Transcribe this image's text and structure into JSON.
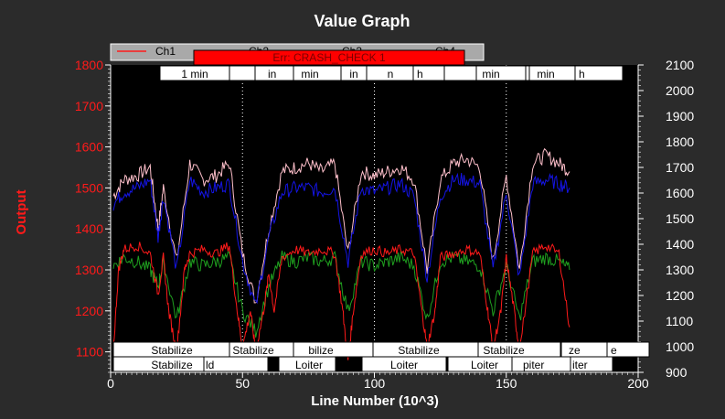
{
  "title": "Value Graph",
  "xlabel": "Line Number (10^3)",
  "ylabel": "Output",
  "legend": {
    "visible_labels": [
      "Ch1",
      "Ch2",
      "Ch3",
      "Ch4"
    ]
  },
  "error_banner": "Err: CRASH_CHECK 1",
  "time_markers": [
    "1 min",
    "in",
    "min",
    "in",
    "n",
    "h",
    "min",
    "min",
    "h"
  ],
  "mode_row_1": [
    "Stabilize",
    "Stabilize",
    "bilize",
    "Stabilize",
    "Stabilize",
    "ze",
    "e"
  ],
  "mode_row_2": [
    "Stabilize",
    "ld",
    "Loiter",
    "Loiter",
    "Loiter",
    "piter",
    "iter"
  ],
  "colors": {
    "background": "#2b2b2b",
    "plot_bg": "#000000",
    "axis_left": "#ff1a1a",
    "axis_text": "#ffffff",
    "ch_red": "#ff1a1a",
    "ch_green": "#1fa01f",
    "ch_blue": "#1414e6",
    "ch_pink": "#ffc0cb",
    "ch_magenta": "#ff00ff"
  },
  "chart_data": {
    "type": "line",
    "xlim": [
      0,
      200
    ],
    "ylim_left": [
      1050,
      1800
    ],
    "ylim_right": [
      900,
      2100
    ],
    "x_ticks": [
      0,
      50,
      100,
      150,
      200
    ],
    "y_left_ticks": [
      1100,
      1200,
      1300,
      1400,
      1500,
      1600,
      1700,
      1800
    ],
    "y_right_ticks": [
      900,
      1000,
      1100,
      1200,
      1300,
      1400,
      1500,
      1600,
      1700,
      1800,
      1900,
      2000,
      2100
    ],
    "vertical_guides_x": [
      50,
      100,
      150
    ],
    "series": [
      {
        "color": "#ffc0cb",
        "axis": "left",
        "x": [
          1,
          5,
          10,
          15,
          18,
          20,
          25,
          30,
          35,
          40,
          45,
          50,
          55,
          60,
          65,
          70,
          75,
          80,
          85,
          90,
          95,
          100,
          105,
          110,
          115,
          120,
          125,
          130,
          135,
          140,
          145,
          150,
          155,
          160,
          165,
          170,
          174
        ],
        "values": [
          1480,
          1520,
          1530,
          1550,
          1400,
          1500,
          1320,
          1560,
          1520,
          1530,
          1560,
          1340,
          1220,
          1400,
          1540,
          1550,
          1560,
          1540,
          1560,
          1340,
          1540,
          1530,
          1540,
          1550,
          1520,
          1300,
          1520,
          1560,
          1570,
          1550,
          1320,
          1530,
          1300,
          1560,
          1580,
          1560,
          1540
        ]
      },
      {
        "color": "#1414e6",
        "axis": "left",
        "x": [
          1,
          5,
          10,
          15,
          18,
          20,
          25,
          30,
          35,
          40,
          45,
          50,
          55,
          60,
          65,
          70,
          75,
          80,
          85,
          90,
          95,
          100,
          105,
          110,
          115,
          120,
          125,
          130,
          135,
          140,
          145,
          150,
          155,
          160,
          165,
          170,
          174
        ],
        "values": [
          1460,
          1490,
          1500,
          1520,
          1380,
          1480,
          1300,
          1520,
          1490,
          1500,
          1510,
          1320,
          1210,
          1380,
          1490,
          1500,
          1500,
          1490,
          1500,
          1320,
          1500,
          1490,
          1500,
          1510,
          1480,
          1280,
          1480,
          1520,
          1520,
          1510,
          1300,
          1490,
          1280,
          1510,
          1520,
          1510,
          1500
        ]
      },
      {
        "color": "#1fa01f",
        "axis": "left",
        "x": [
          1,
          5,
          10,
          15,
          18,
          20,
          25,
          30,
          35,
          40,
          45,
          50,
          55,
          60,
          65,
          70,
          75,
          80,
          85,
          90,
          95,
          100,
          105,
          110,
          115,
          120,
          125,
          130,
          135,
          140,
          145,
          150,
          155,
          160,
          165,
          170,
          174
        ],
        "values": [
          1310,
          1330,
          1320,
          1300,
          1260,
          1320,
          1180,
          1320,
          1310,
          1320,
          1330,
          1200,
          1150,
          1260,
          1330,
          1320,
          1330,
          1320,
          1330,
          1200,
          1320,
          1310,
          1320,
          1330,
          1310,
          1180,
          1320,
          1330,
          1320,
          1310,
          1200,
          1310,
          1180,
          1320,
          1330,
          1320,
          1300
        ]
      },
      {
        "color": "#ff1a1a",
        "axis": "left",
        "x": [
          1,
          3,
          5,
          10,
          15,
          18,
          20,
          22,
          25,
          28,
          30,
          35,
          40,
          45,
          48,
          50,
          53,
          55,
          58,
          60,
          62,
          65,
          70,
          75,
          80,
          85,
          88,
          90,
          92,
          95,
          100,
          105,
          110,
          115,
          118,
          120,
          123,
          125,
          130,
          135,
          140,
          143,
          145,
          148,
          150,
          153,
          155,
          160,
          165,
          170,
          174
        ],
        "values": [
          1100,
          1300,
          1350,
          1360,
          1340,
          1240,
          1330,
          1200,
          1100,
          1300,
          1340,
          1350,
          1340,
          1360,
          1200,
          1110,
          1200,
          1100,
          1200,
          1290,
          1200,
          1330,
          1350,
          1340,
          1350,
          1340,
          1200,
          1080,
          1200,
          1340,
          1350,
          1340,
          1350,
          1340,
          1200,
          1110,
          1200,
          1330,
          1340,
          1350,
          1340,
          1200,
          1110,
          1200,
          1330,
          1200,
          1100,
          1340,
          1360,
          1340,
          1160
        ]
      }
    ]
  }
}
